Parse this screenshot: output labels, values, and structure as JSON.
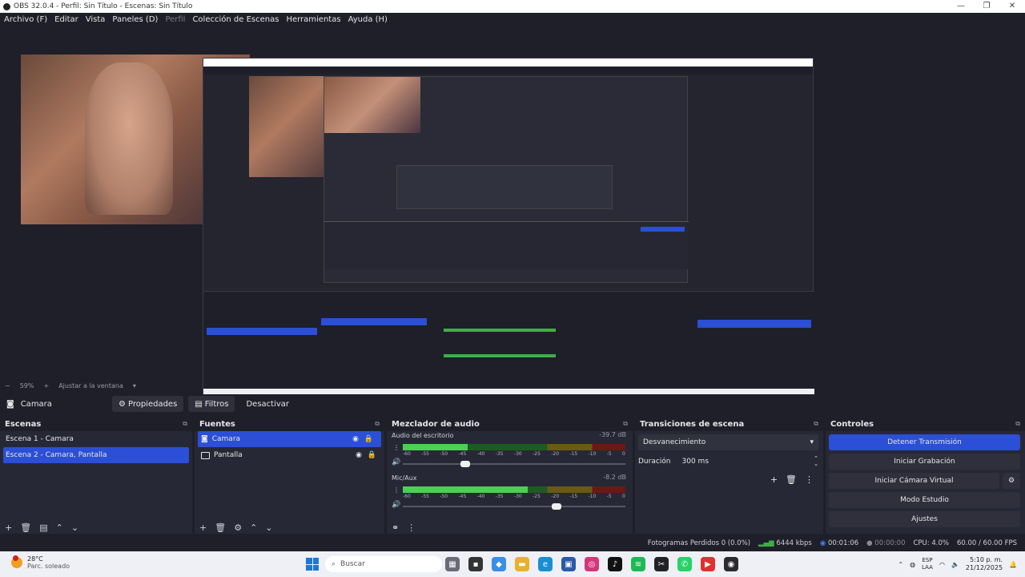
{
  "window": {
    "title": "OBS 32.0.4 - Perfil: Sin Título - Escenas: Sin Título"
  },
  "menu": [
    {
      "label": "Archivo (F)",
      "enabled": true
    },
    {
      "label": "Editar",
      "enabled": true
    },
    {
      "label": "Vista",
      "enabled": true
    },
    {
      "label": "Paneles (D)",
      "enabled": true
    },
    {
      "label": "Perfil",
      "enabled": false
    },
    {
      "label": "Colección de Escenas",
      "enabled": true
    },
    {
      "label": "Herramientas",
      "enabled": true
    },
    {
      "label": "Ayuda (H)",
      "enabled": true
    }
  ],
  "zoom": {
    "percent": "59%",
    "fit": "Ajustar a la ventana"
  },
  "source_toolbar": {
    "source": "Camara",
    "properties": "Propiedades",
    "filters": "Filtros",
    "deactivate": "Desactivar"
  },
  "scenes": {
    "title": "Escenas",
    "items": [
      {
        "label": "Escena 1 - Camara",
        "selected": false
      },
      {
        "label": "Escena 2 - Camara, Pantalla",
        "selected": true
      }
    ]
  },
  "sources": {
    "title": "Fuentes",
    "items": [
      {
        "label": "Camara",
        "selected": true
      },
      {
        "label": "Pantalla",
        "selected": false
      }
    ]
  },
  "mixer": {
    "title": "Mezclador de audio",
    "ticks": [
      "-60",
      "-55",
      "-50",
      "-45",
      "-40",
      "-35",
      "-30",
      "-25",
      "-20",
      "-15",
      "-10",
      "-5",
      "0"
    ],
    "channels": [
      {
        "name": "Audio del escritorio",
        "db": "-39.7 dB",
        "level": 0.29,
        "volume": 0.28
      },
      {
        "name": "Mic/Aux",
        "db": "-8.2 dB",
        "level": 0.56,
        "volume": 0.69
      }
    ]
  },
  "transitions": {
    "title": "Transiciones de escena",
    "type": "Desvanecimiento",
    "duration_label": "Duración",
    "duration_value": "300 ms"
  },
  "controls": {
    "title": "Controles",
    "stop_stream": "Detener Transmisión",
    "start_recording": "Iniciar Grabación",
    "start_virtualcam": "Iniciar Cámara Virtual",
    "studio_mode": "Modo Estudio",
    "settings": "Ajustes"
  },
  "status": {
    "dropped": "Fotogramas Perdidos 0 (0.0%)",
    "bitrate": "6444 kbps",
    "stream_time": "00:01:06",
    "rec_time": "00:00:00",
    "cpu": "CPU: 4.0%",
    "fps": "60.00 / 60.00 FPS"
  },
  "taskbar": {
    "temp": "28°C",
    "weather": "Parc. soleado",
    "search": "Buscar",
    "lang_top": "ESP",
    "lang_bottom": "LAA",
    "time": "5:10 p. m.",
    "date": "21/12/2025",
    "apps": [
      {
        "name": "apps-icon",
        "color": "#6a6a78",
        "glyph": "▦"
      },
      {
        "name": "terminal-icon",
        "color": "#333333",
        "glyph": "▪"
      },
      {
        "name": "copilot-icon",
        "color": "#3a8ee6",
        "glyph": "◆"
      },
      {
        "name": "folder-icon",
        "color": "#e8b12c",
        "glyph": "▬"
      },
      {
        "name": "edge-icon",
        "color": "#1a8fd0",
        "glyph": "e"
      },
      {
        "name": "store-icon",
        "color": "#2a5aa8",
        "glyph": "▣"
      },
      {
        "name": "instagram-icon",
        "color": "#d3367a",
        "glyph": "◎"
      },
      {
        "name": "tiktok-icon",
        "color": "#111111",
        "glyph": "♪"
      },
      {
        "name": "spotify-icon",
        "color": "#1db954",
        "glyph": "≋"
      },
      {
        "name": "capcut-icon",
        "color": "#222222",
        "glyph": "✂"
      },
      {
        "name": "whatsapp-icon",
        "color": "#25d366",
        "glyph": "✆"
      },
      {
        "name": "app-red-icon",
        "color": "#e03030",
        "glyph": "▶"
      },
      {
        "name": "obs-icon",
        "color": "#2a2a30",
        "glyph": "◉"
      }
    ]
  }
}
